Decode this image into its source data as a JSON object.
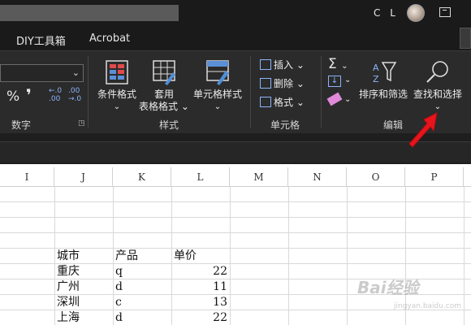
{
  "titlebar": {
    "user_initials": "C L"
  },
  "tabs": [
    {
      "label": "DIY工具箱"
    },
    {
      "label": "Acrobat"
    }
  ],
  "ribbon": {
    "number_group": {
      "label": "数字",
      "percent": "%",
      "comma": "❜",
      "inc_decimal": "←.0 .00",
      "dec_decimal": ".00 →.0"
    },
    "styles_group": {
      "label": "样式",
      "conditional_format": "条件格式",
      "table_format_1": "套用",
      "table_format_2": "表格格式",
      "cell_styles": "单元格样式"
    },
    "cells_group": {
      "label": "单元格",
      "insert": "插入",
      "delete": "删除",
      "format": "格式"
    },
    "editing_group": {
      "label": "编辑",
      "sort_filter": "排序和筛选",
      "find_select": "查找和选择"
    }
  },
  "columns": [
    "I",
    "J",
    "K",
    "L",
    "M",
    "N",
    "O",
    "P"
  ],
  "table": {
    "headers": [
      "城市",
      "产品",
      "单价"
    ],
    "rows": [
      [
        "重庆",
        "q",
        "22"
      ],
      [
        "广州",
        "d",
        "11"
      ],
      [
        "深圳",
        "c",
        "13"
      ],
      [
        "上海",
        "d",
        "22"
      ]
    ]
  },
  "colors": {
    "arrow": "#e8141c",
    "ribbon_bg": "#2b2b2b",
    "accent_blue": "#8ab4f8"
  },
  "watermark": {
    "brand": "Bai经验",
    "sub": "jingyan.baidu.com"
  }
}
